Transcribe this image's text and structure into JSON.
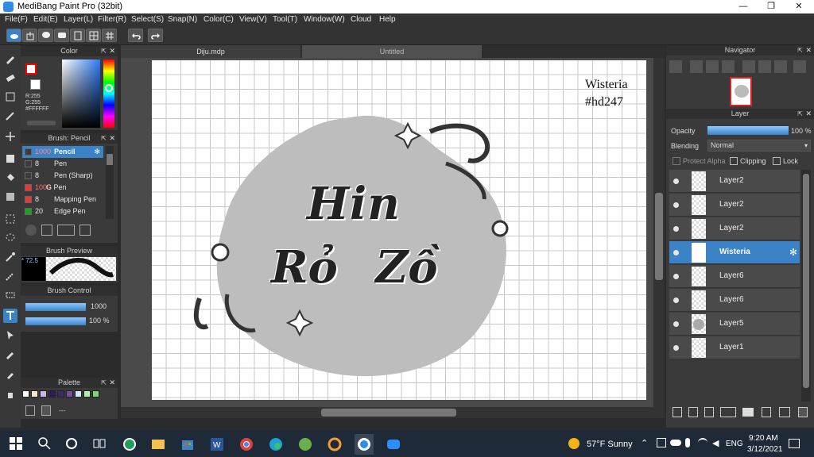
{
  "window": {
    "title": "MediBang Paint Pro (32bit)",
    "minimize": "—",
    "maximize": "❐",
    "close": "✕"
  },
  "menu": [
    "File(F)",
    "Edit(E)",
    "Layer(L)",
    "Filter(R)",
    "Select(S)",
    "Snap(N)",
    "Color(C)",
    "View(V)",
    "Tool(T)",
    "Window(W)",
    "Cloud",
    "Help"
  ],
  "color_panel": {
    "title": "Color",
    "primary": "#ff0000",
    "r": "R:255",
    "g": "G:255",
    "b": "B:255",
    "hex": "#FFFFFF"
  },
  "brush_panel": {
    "title": "Brush: Pencil",
    "items": [
      {
        "size": "1000",
        "name": "Pencil",
        "swatch": "#3c3c3c"
      },
      {
        "size": "8",
        "name": "Pen",
        "swatch": "#3c3c3c"
      },
      {
        "size": "8",
        "name": "Pen (Sharp)",
        "swatch": "#3c3c3c"
      },
      {
        "size": "1000",
        "name": "G Pen",
        "swatch": "#e53935"
      },
      {
        "size": "8",
        "name": "Mapping Pen",
        "swatch": "#e53935"
      },
      {
        "size": "20",
        "name": "Edge Pen",
        "swatch": "#1aa51a"
      }
    ]
  },
  "brush_preview": {
    "title": "Brush Preview",
    "value": "72.5"
  },
  "brush_control": {
    "title": "Brush Control",
    "size": "1000",
    "opacity": "100 %"
  },
  "palette": {
    "title": "Palette",
    "colors": [
      "#ffffff",
      "#f2e9c6",
      "#c9b7e6",
      "#2a1f5a",
      "#3c2a6a",
      "#7a4ea3",
      "#cfe9ff",
      "#b6f0b0",
      "#7ad47a"
    ],
    "extra": "---"
  },
  "tabs": {
    "tab1": "Diju.mdp",
    "tab2": "Untitled"
  },
  "artwork": {
    "title_top": "Hin",
    "title_bottom": "Rỏ Zồ",
    "watermark_line1": "Wisteria",
    "watermark_line2": "#hd247"
  },
  "navigator": {
    "title": "Navigator"
  },
  "layer_panel": {
    "title": "Layer",
    "opacity_label": "Opacity",
    "opacity_value": "100 %",
    "opacity": 1.0,
    "blending_label": "Blending",
    "blending_value": "Normal",
    "protect_alpha": "Protect Alpha",
    "clipping": "Clipping",
    "lock": "Lock",
    "layers": [
      "Layer2",
      "Layer2",
      "Layer2",
      "Wisteria",
      "Layer6",
      "Layer6",
      "Layer5",
      "Layer1"
    ],
    "selected": "Wisteria"
  },
  "taskbar": {
    "weather": "57°F  Sunny",
    "lang": "ENG",
    "time": "9:20 AM",
    "date": "3/12/2021"
  }
}
